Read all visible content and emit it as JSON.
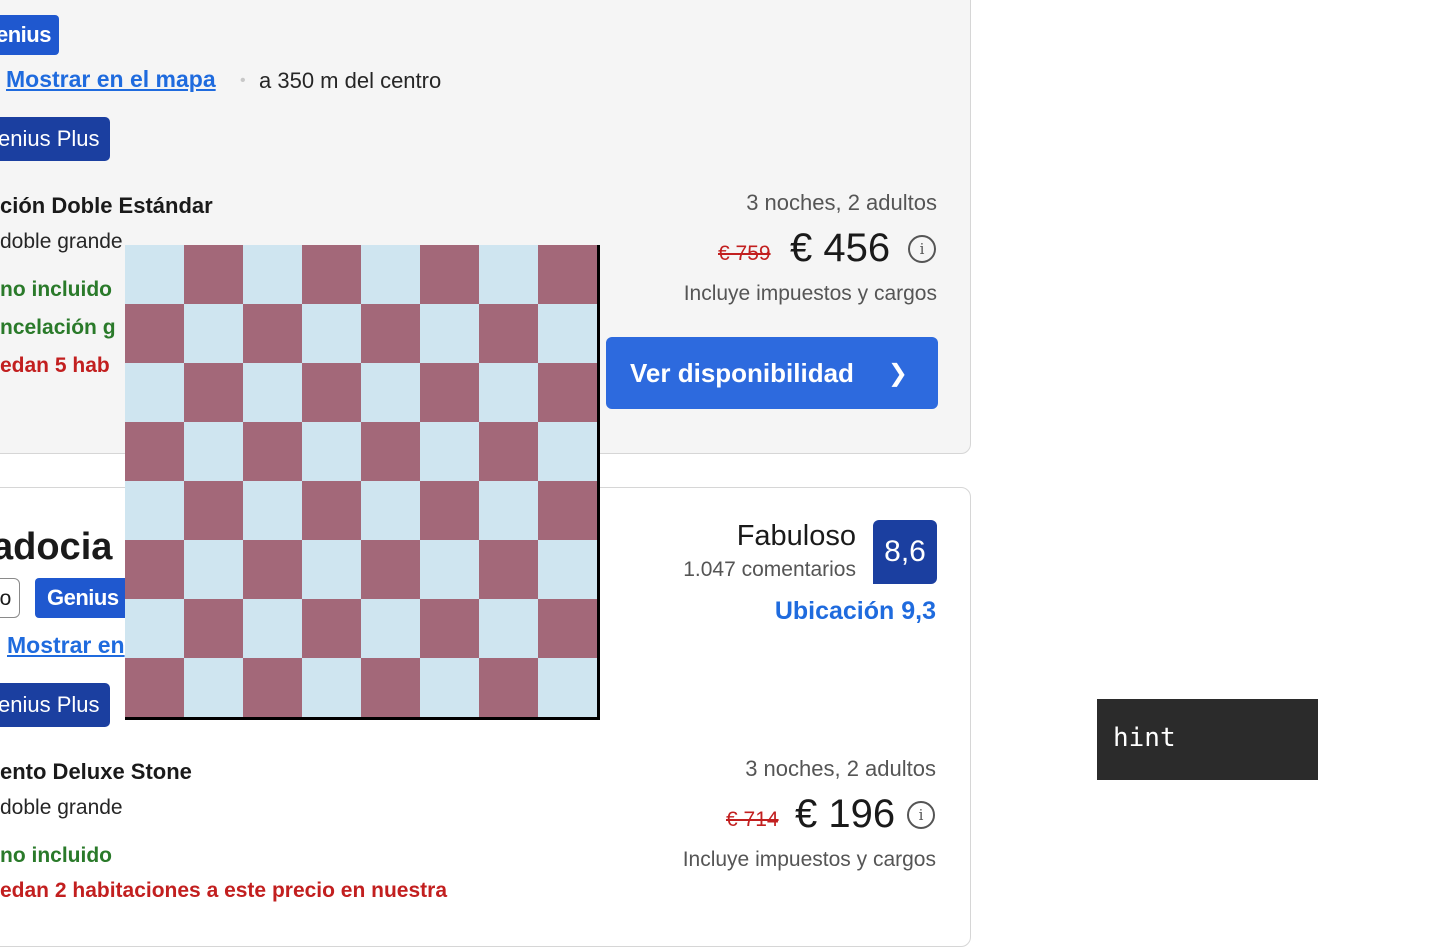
{
  "listing1": {
    "genius_badge": "enius",
    "map_link": "Mostrar en el mapa",
    "distance": "a 350 m del centro",
    "genius_plus": "enius Plus",
    "room_title": "ción Doble Estándar",
    "bed": "doble grande",
    "green1": "no incluido",
    "green2": "ncelación g",
    "red1": "edan 5 hab",
    "nights": "3 noches, 2 adultos",
    "old_price": "€ 759",
    "price": "€ 456",
    "taxes": "Incluye impuestos y cargos",
    "button": "Ver disponibilidad"
  },
  "listing2": {
    "hotel_name": "adocia",
    "stars_box": "lo",
    "genius_badge": "Genius",
    "map_link": "Mostrar en",
    "genius_plus": "enius Plus",
    "rating_word": "Fabuloso",
    "reviews": "1.047 comentarios",
    "score": "8,6",
    "location_score": "Ubicación 9,3",
    "room_title": "ento Deluxe Stone",
    "bed": "doble grande",
    "green1": "no incluido",
    "red1": "edan 2 habitaciones a este precio en nuestra",
    "nights": "3 noches, 2 adultos",
    "old_price": "€ 714",
    "price": "€ 196",
    "taxes": "Incluye impuestos y cargos"
  },
  "overlay": {
    "checker_colors": [
      "#cfe5f0",
      "#a36879"
    ],
    "checker_grid": 8
  },
  "tooltip": {
    "text": "hint"
  }
}
